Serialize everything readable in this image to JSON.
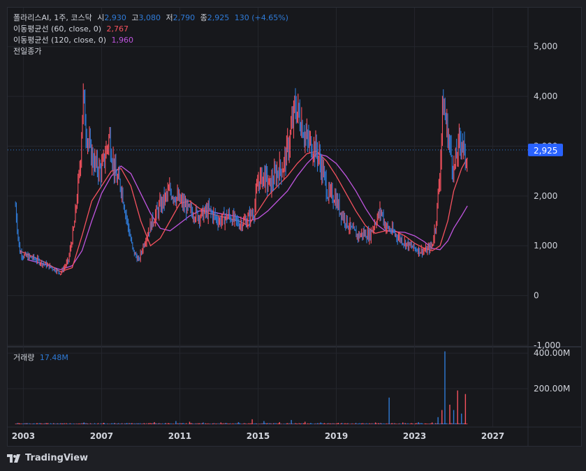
{
  "header": {
    "symbol": "폴라리스AI, 1주, 코스닥",
    "open_label": "시",
    "open": "2,930",
    "high_label": "고",
    "high": "3,080",
    "low_label": "저",
    "low": "2,790",
    "close_label": "종",
    "close": "2,925",
    "change": "130 (+4.65%)"
  },
  "indicators": {
    "ma60_label": "이동평균선 (60, close, 0)",
    "ma60_value": "2,767",
    "ma60_color": "#f7525f",
    "ma120_label": "이동평균선 (120, close, 0)",
    "ma120_value": "1,960",
    "ma120_color": "#c055e0",
    "prev_close_label": "전일종가"
  },
  "volume_legend": {
    "label": "거래량",
    "value": "17.48M"
  },
  "brand": "TradingView",
  "colors": {
    "up": "#f7525f",
    "down": "#2f7bd8",
    "price_tag": "#2962ff",
    "background": "#17181c"
  },
  "chart_data": {
    "type": "line",
    "title": "폴라리스AI, 1주, 코스닥",
    "price_axis": {
      "ylim": [
        -1000,
        5500
      ],
      "ticks": [
        -1000,
        0,
        1000,
        2000,
        3000,
        4000,
        5000
      ],
      "tick_labels": [
        "-1,000",
        "0",
        "1,000",
        "2,000",
        "3,000",
        "4,000",
        "5,000"
      ]
    },
    "volume_axis": {
      "ylim": [
        0,
        420
      ],
      "ticks": [
        200,
        400
      ],
      "tick_labels": [
        "200.00M",
        "400.00M"
      ]
    },
    "x_axis": {
      "xlim": [
        2002.2,
        2028.8
      ],
      "ticks": [
        2003,
        2007,
        2011,
        2015,
        2019,
        2023,
        2027
      ],
      "tick_labels": [
        "2003",
        "2007",
        "2011",
        "2015",
        "2019",
        "2023",
        "2027"
      ]
    },
    "last_price": 2925,
    "last_price_label": "2,925",
    "price_series": {
      "name": "폴라리스AI",
      "x": [
        2002.6,
        2002.8,
        2003.0,
        2003.5,
        2004.0,
        2004.5,
        2004.9,
        2005.3,
        2005.6,
        2005.9,
        2006.05,
        2006.2,
        2006.4,
        2006.7,
        2007.0,
        2007.4,
        2007.7,
        2008.0,
        2008.3,
        2008.6,
        2008.9,
        2009.2,
        2009.6,
        2010.0,
        2010.5,
        2011.0,
        2011.5,
        2012.0,
        2012.5,
        2013.0,
        2013.5,
        2014.0,
        2014.4,
        2014.8,
        2015.0,
        2015.3,
        2015.6,
        2016.0,
        2016.3,
        2016.6,
        2016.9,
        2017.2,
        2017.5,
        2017.8,
        2018.0,
        2018.3,
        2018.6,
        2018.9,
        2019.2,
        2019.5,
        2019.8,
        2020.1,
        2020.4,
        2020.7,
        2021.0,
        2021.3,
        2021.5,
        2021.8,
        2022.1,
        2022.4,
        2022.7,
        2023.0,
        2023.3,
        2023.6,
        2023.9,
        2024.1,
        2024.3,
        2024.45,
        2024.6,
        2024.8,
        2025.0,
        2025.2,
        2025.4,
        2025.6,
        2025.7
      ],
      "close": [
        1800,
        900,
        800,
        750,
        650,
        550,
        450,
        700,
        1400,
        2600,
        4000,
        3400,
        2900,
        2600,
        2500,
        3200,
        2400,
        2200,
        1500,
        900,
        700,
        1100,
        1500,
        1800,
        2100,
        1900,
        1700,
        1600,
        1700,
        1500,
        1600,
        1450,
        1500,
        1700,
        2300,
        2400,
        2200,
        2500,
        2600,
        3100,
        3800,
        3500,
        3100,
        3000,
        2900,
        2500,
        2000,
        2000,
        1700,
        1500,
        1300,
        1200,
        1250,
        1200,
        1500,
        1700,
        1400,
        1300,
        1200,
        1100,
        1000,
        950,
        900,
        900,
        1000,
        1500,
        2500,
        3900,
        3500,
        3000,
        2500,
        2900,
        3200,
        2700,
        2925
      ]
    },
    "ma60_series": {
      "name": "이동평균선 (60, close, 0)",
      "x": [
        2002.8,
        2003.5,
        2004.2,
        2004.9,
        2005.5,
        2006.0,
        2006.5,
        2007.0,
        2007.5,
        2008.0,
        2008.5,
        2009.0,
        2009.5,
        2010.0,
        2010.5,
        2011.0,
        2011.5,
        2012.0,
        2012.5,
        2013.0,
        2013.5,
        2014.0,
        2014.5,
        2015.0,
        2015.5,
        2016.0,
        2016.5,
        2017.0,
        2017.5,
        2018.0,
        2018.5,
        2019.0,
        2019.5,
        2020.0,
        2020.5,
        2021.0,
        2021.5,
        2022.0,
        2022.5,
        2023.0,
        2023.5,
        2023.9,
        2024.3,
        2024.7,
        2025.0,
        2025.4,
        2025.7
      ],
      "values": [
        900,
        780,
        650,
        480,
        560,
        1200,
        1900,
        2200,
        2500,
        2550,
        2200,
        1500,
        1000,
        1150,
        1500,
        1850,
        1900,
        1750,
        1650,
        1600,
        1550,
        1500,
        1400,
        1700,
        2000,
        2200,
        2400,
        2650,
        2850,
        2900,
        2700,
        2400,
        2050,
        1700,
        1400,
        1250,
        1300,
        1300,
        1200,
        1050,
        950,
        900,
        1000,
        1500,
        2100,
        2550,
        2767
      ]
    },
    "ma120_series": {
      "name": "이동평균선 (120, close, 0)",
      "x": [
        2003.2,
        2004.0,
        2004.9,
        2005.5,
        2006.0,
        2006.5,
        2007.0,
        2007.5,
        2008.0,
        2008.5,
        2009.0,
        2009.5,
        2010.0,
        2010.5,
        2011.0,
        2011.5,
        2012.0,
        2012.5,
        2013.0,
        2013.5,
        2014.0,
        2014.5,
        2015.0,
        2015.5,
        2016.0,
        2016.5,
        2017.0,
        2017.5,
        2018.0,
        2018.5,
        2019.0,
        2019.5,
        2020.0,
        2020.5,
        2021.0,
        2021.5,
        2022.0,
        2022.5,
        2023.0,
        2023.5,
        2023.9,
        2024.3,
        2024.7,
        2025.0,
        2025.4,
        2025.7
      ],
      "values": [
        720,
        640,
        520,
        600,
        900,
        1500,
        2050,
        2400,
        2600,
        2450,
        2050,
        1650,
        1350,
        1300,
        1450,
        1600,
        1700,
        1700,
        1650,
        1620,
        1580,
        1500,
        1550,
        1700,
        1900,
        2100,
        2400,
        2650,
        2850,
        2800,
        2650,
        2400,
        2100,
        1750,
        1450,
        1300,
        1280,
        1270,
        1200,
        1080,
        950,
        920,
        1100,
        1350,
        1600,
        1800,
        1960
      ]
    },
    "volume_series": {
      "name": "거래량",
      "x": [
        2003.5,
        2005.0,
        2006.1,
        2007.1,
        2008.3,
        2009.7,
        2010.8,
        2011.5,
        2012.2,
        2013.1,
        2014.0,
        2014.7,
        2015.3,
        2016.1,
        2016.7,
        2017.4,
        2018.2,
        2019.1,
        2020.0,
        2021.0,
        2021.7,
        2022.4,
        2023.2,
        2023.9,
        2024.2,
        2024.4,
        2024.55,
        2024.8,
        2025.0,
        2025.2,
        2025.4,
        2025.6
      ],
      "values": [
        3,
        4,
        10,
        8,
        6,
        12,
        18,
        14,
        10,
        10,
        12,
        28,
        18,
        12,
        24,
        14,
        10,
        8,
        8,
        10,
        150,
        10,
        12,
        10,
        40,
        80,
        410,
        110,
        80,
        190,
        60,
        170
      ]
    }
  }
}
